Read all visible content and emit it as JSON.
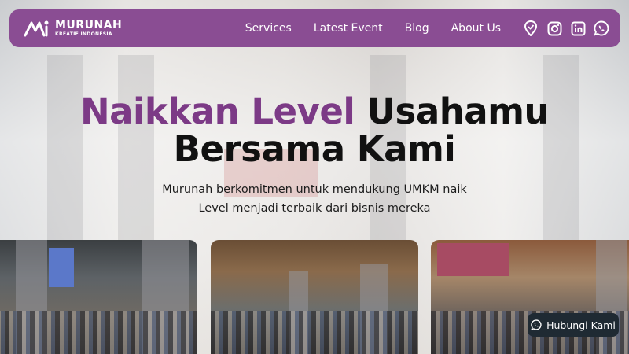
{
  "brand": {
    "name": "MURUNAH",
    "tagline": "KREATIF INDONESIA",
    "color": "#8a4d93"
  },
  "nav": {
    "links": [
      "Services",
      "Latest Event",
      "Blog",
      "About Us"
    ],
    "icons": [
      "location-icon",
      "instagram-icon",
      "linkedin-icon",
      "whatsapp-icon"
    ]
  },
  "hero": {
    "title_accent": "Naikkan Level",
    "title_rest": "Usahamu",
    "title_line2": "Bersama Kami",
    "subtitle_line1": "Murunah berkomitmen untuk mendukung UMKM naik",
    "subtitle_line2": "Level menjadi terbaik dari bisnis mereka"
  },
  "contact": {
    "label": "Hubungi Kami",
    "icon": "whatsapp-icon"
  },
  "colors": {
    "accent": "#7c3a86",
    "dark_button": "#1f2a33"
  }
}
